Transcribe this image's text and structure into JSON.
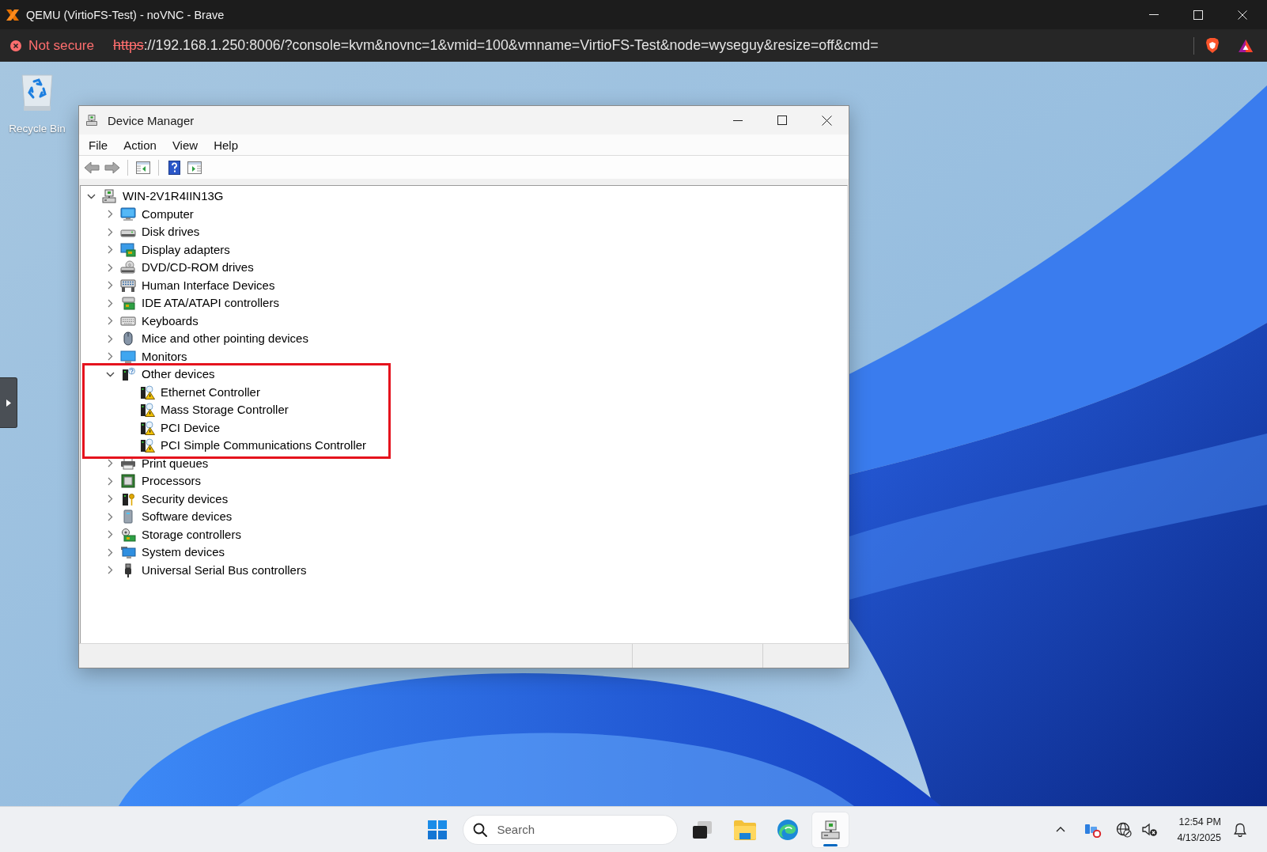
{
  "browser": {
    "title": "QEMU (VirtioFS-Test) - noVNC - Brave",
    "security_label": "Not secure",
    "url_scheme": "https",
    "url_rest": "://192.168.1.250:8006/?console=kvm&novnc=1&vmid=100&vmname=VirtioFS-Test&node=wyseguy&resize=off&cmd="
  },
  "desktop": {
    "icons": [
      {
        "kind": "recycle-bin",
        "label": "Recycle Bin"
      }
    ]
  },
  "window": {
    "title": "Device Manager",
    "menu": [
      "File",
      "Action",
      "View",
      "Help"
    ],
    "tree": {
      "label": "WIN-2V1R4IIN13G",
      "expanded": true,
      "children": [
        {
          "label": "Computer",
          "kind": "computer",
          "expanded": false,
          "highlighted": false
        },
        {
          "label": "Disk drives",
          "kind": "disk",
          "expanded": false,
          "highlighted": false
        },
        {
          "label": "Display adapters",
          "kind": "display",
          "expanded": false,
          "highlighted": false
        },
        {
          "label": "DVD/CD-ROM drives",
          "kind": "dvd",
          "expanded": false,
          "highlighted": false
        },
        {
          "label": "Human Interface Devices",
          "kind": "hid",
          "expanded": false,
          "highlighted": false
        },
        {
          "label": "IDE ATA/ATAPI controllers",
          "kind": "ide",
          "expanded": false,
          "highlighted": false
        },
        {
          "label": "Keyboards",
          "kind": "keyboard",
          "expanded": false,
          "highlighted": false
        },
        {
          "label": "Mice and other pointing devices",
          "kind": "mouse",
          "expanded": false,
          "highlighted": false
        },
        {
          "label": "Monitors",
          "kind": "monitor",
          "expanded": false,
          "highlighted": false
        },
        {
          "label": "Other devices",
          "kind": "other",
          "expanded": true,
          "highlighted": true,
          "children": [
            {
              "label": "Ethernet Controller",
              "kind": "unknown"
            },
            {
              "label": "Mass Storage Controller",
              "kind": "unknown"
            },
            {
              "label": "PCI Device",
              "kind": "unknown"
            },
            {
              "label": "PCI Simple Communications Controller",
              "kind": "unknown"
            }
          ]
        },
        {
          "label": "Print queues",
          "kind": "printer",
          "expanded": false,
          "highlighted": false
        },
        {
          "label": "Processors",
          "kind": "processor",
          "expanded": false,
          "highlighted": false
        },
        {
          "label": "Security devices",
          "kind": "security",
          "expanded": false,
          "highlighted": false
        },
        {
          "label": "Software devices",
          "kind": "software",
          "expanded": false,
          "highlighted": false
        },
        {
          "label": "Storage controllers",
          "kind": "storage",
          "expanded": false,
          "highlighted": false
        },
        {
          "label": "System devices",
          "kind": "system",
          "expanded": false,
          "highlighted": false
        },
        {
          "label": "Universal Serial Bus controllers",
          "kind": "usb",
          "expanded": false,
          "highlighted": false
        }
      ]
    }
  },
  "taskbar": {
    "search": {
      "placeholder": "Search"
    },
    "apps": [
      {
        "kind": "task-view",
        "active": false
      },
      {
        "kind": "file-explorer",
        "active": false
      },
      {
        "kind": "browser",
        "active": false
      },
      {
        "kind": "device-manager",
        "active": true
      }
    ],
    "clock": {
      "time": "12:54 PM",
      "date": "4/13/2025"
    }
  }
}
